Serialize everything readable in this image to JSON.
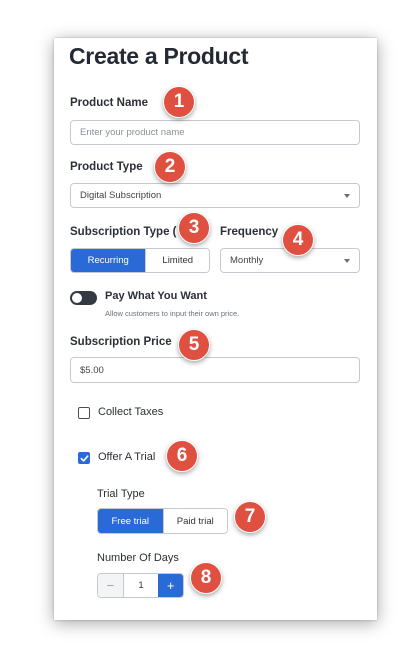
{
  "form": {
    "title": "Create a Product",
    "product_name": {
      "label": "Product Name",
      "placeholder": "Enter your product name"
    },
    "product_type": {
      "label": "Product Type",
      "value": "Digital Subscription"
    },
    "subscription_type": {
      "label": "Subscription Type (",
      "options": [
        "Recurring",
        "Limited"
      ],
      "selected": "Recurring"
    },
    "frequency": {
      "label": "Frequency",
      "value": "Monthly"
    },
    "pay_what_you_want": {
      "label": "Pay What You Want",
      "hint": "Allow customers to input their own price.",
      "on": false
    },
    "subscription_price": {
      "label": "Subscription Price",
      "value": "$5.00"
    },
    "collect_taxes": {
      "label": "Collect Taxes",
      "checked": false
    },
    "offer_trial": {
      "label": "Offer A Trial",
      "checked": true
    },
    "trial_type": {
      "label": "Trial Type",
      "options": [
        "Free trial",
        "Paid trial"
      ],
      "selected": "Free trial"
    },
    "number_of_days": {
      "label": "Number Of Days",
      "value": "1",
      "minus": "−",
      "plus": "+"
    }
  },
  "annotations": [
    "1",
    "2",
    "3",
    "4",
    "5",
    "6",
    "7",
    "8"
  ],
  "colors": {
    "accent": "#2a6ad6",
    "badge": "#df5040",
    "toggle_off": "#343a42"
  }
}
